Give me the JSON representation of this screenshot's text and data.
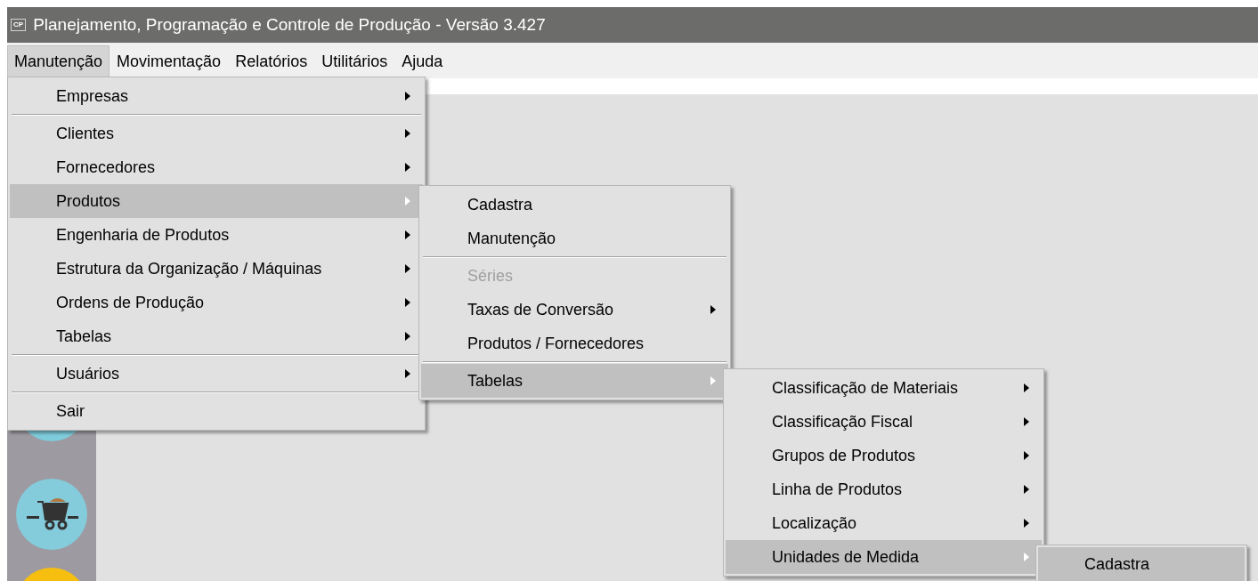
{
  "window": {
    "title": "Planejamento, Programação e Controle de Produção - Versão 3.427",
    "icon_text": "CP"
  },
  "menubar": [
    {
      "label": "Manutenção",
      "selected": true
    },
    {
      "label": "Movimentação",
      "selected": false
    },
    {
      "label": "Relatórios",
      "selected": false
    },
    {
      "label": "Utilitários",
      "selected": false
    },
    {
      "label": "Ajuda",
      "selected": false
    }
  ],
  "menus": [
    {
      "items": [
        {
          "kind": "item",
          "label": "Empresas",
          "submenu": true,
          "selected": false,
          "disabled": false
        },
        {
          "kind": "separator"
        },
        {
          "kind": "item",
          "label": "Clientes",
          "submenu": true,
          "selected": false,
          "disabled": false
        },
        {
          "kind": "item",
          "label": "Fornecedores",
          "submenu": true,
          "selected": false,
          "disabled": false
        },
        {
          "kind": "item",
          "label": "Produtos",
          "submenu": true,
          "selected": true,
          "disabled": false
        },
        {
          "kind": "item",
          "label": "Engenharia de Produtos",
          "submenu": true,
          "selected": false,
          "disabled": false
        },
        {
          "kind": "item",
          "label": "Estrutura da Organização / Máquinas",
          "submenu": true,
          "selected": false,
          "disabled": false
        },
        {
          "kind": "item",
          "label": "Ordens de Produção",
          "submenu": true,
          "selected": false,
          "disabled": false
        },
        {
          "kind": "item",
          "label": "Tabelas",
          "submenu": true,
          "selected": false,
          "disabled": false
        },
        {
          "kind": "separator"
        },
        {
          "kind": "item",
          "label": "Usuários",
          "submenu": true,
          "selected": false,
          "disabled": false
        },
        {
          "kind": "separator"
        },
        {
          "kind": "item",
          "label": "Sair",
          "submenu": false,
          "selected": false,
          "disabled": false
        }
      ]
    },
    {
      "items": [
        {
          "kind": "item",
          "label": "Cadastra",
          "submenu": false,
          "selected": false,
          "disabled": false
        },
        {
          "kind": "item",
          "label": "Manutenção",
          "submenu": false,
          "selected": false,
          "disabled": false
        },
        {
          "kind": "separator"
        },
        {
          "kind": "item",
          "label": "Séries",
          "submenu": false,
          "selected": false,
          "disabled": true
        },
        {
          "kind": "item",
          "label": "Taxas de Conversão",
          "submenu": true,
          "selected": false,
          "disabled": false
        },
        {
          "kind": "item",
          "label": "Produtos / Fornecedores",
          "submenu": false,
          "selected": false,
          "disabled": false
        },
        {
          "kind": "separator"
        },
        {
          "kind": "item",
          "label": "Tabelas",
          "submenu": true,
          "selected": true,
          "disabled": false
        }
      ]
    },
    {
      "items": [
        {
          "kind": "item",
          "label": "Classificação de Materiais",
          "submenu": true,
          "selected": false,
          "disabled": false
        },
        {
          "kind": "item",
          "label": "Classificação Fiscal",
          "submenu": true,
          "selected": false,
          "disabled": false
        },
        {
          "kind": "item",
          "label": "Grupos de Produtos",
          "submenu": true,
          "selected": false,
          "disabled": false
        },
        {
          "kind": "item",
          "label": "Linha de Produtos",
          "submenu": true,
          "selected": false,
          "disabled": false
        },
        {
          "kind": "item",
          "label": "Localização",
          "submenu": true,
          "selected": false,
          "disabled": false
        },
        {
          "kind": "item",
          "label": "Unidades de Medida",
          "submenu": true,
          "selected": true,
          "disabled": false
        }
      ]
    },
    {
      "items": [
        {
          "kind": "item",
          "label": "Cadastra",
          "submenu": false,
          "selected": true,
          "disabled": false
        }
      ]
    }
  ]
}
